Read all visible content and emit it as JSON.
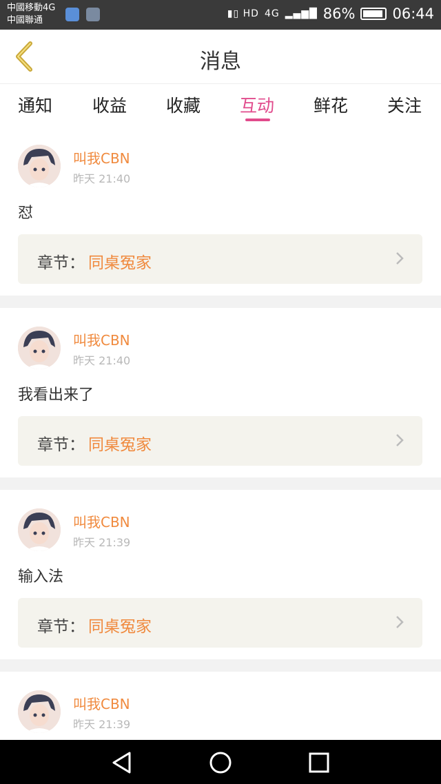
{
  "status_bar": {
    "carrier_line1": "中國移動4G",
    "carrier_line2": "中國聯通",
    "signal_text": "4G",
    "battery": "86%",
    "time": "06:44"
  },
  "header": {
    "title": "消息",
    "back_icon": "back-chevron-icon"
  },
  "tabs": [
    {
      "label": "通知"
    },
    {
      "label": "收益"
    },
    {
      "label": "收藏"
    },
    {
      "label": "互动",
      "active": true
    },
    {
      "label": "鲜花"
    },
    {
      "label": "关注"
    }
  ],
  "messages": [
    {
      "user": "叫我CBN",
      "time": "昨天 21:40",
      "text": "怼",
      "chapter_label": "章节：",
      "chapter_name": "同桌冤家"
    },
    {
      "user": "叫我CBN",
      "time": "昨天 21:40",
      "text": "我看出来了",
      "chapter_label": "章节：",
      "chapter_name": "同桌冤家"
    },
    {
      "user": "叫我CBN",
      "time": "昨天 21:39",
      "text": "输入法",
      "chapter_label": "章节：",
      "chapter_name": "同桌冤家"
    },
    {
      "user": "叫我CBN",
      "time": "昨天 21:39"
    }
  ],
  "colors": {
    "accent": "#e14b8c",
    "username": "#f08a3e",
    "chapter_bg": "#f4f3ed"
  }
}
